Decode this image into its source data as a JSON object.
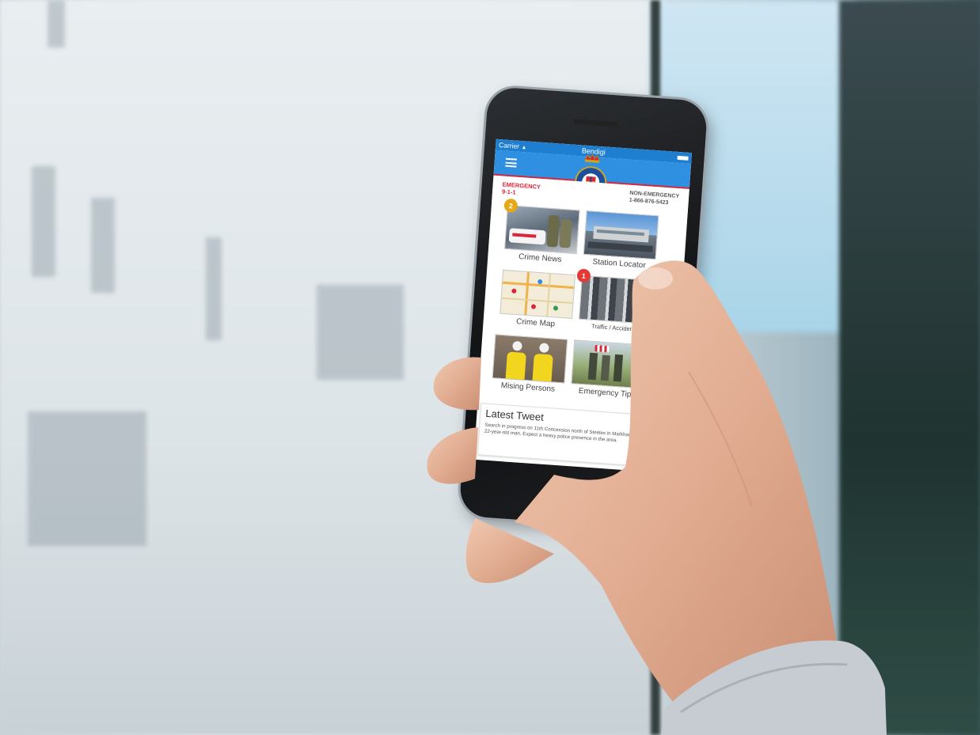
{
  "status_bar": {
    "carrier": "Carrier",
    "wifi_icon": "wifi-icon",
    "title": "Bendigi"
  },
  "header": {
    "menu_icon": "hamburger-menu-icon",
    "logo": "police-crest-logo"
  },
  "contacts": {
    "emergency_label": "EMERGENCY",
    "emergency_number": "9-1-1",
    "non_emergency_label": "NON-EMERGENCY",
    "non_emergency_number": "1-866-876-5423"
  },
  "tiles": [
    {
      "label": "Crime News",
      "badge": "2"
    },
    {
      "label": "Station Locator",
      "badge": ""
    },
    {
      "label": "Crime Map",
      "badge": ""
    },
    {
      "label": "Traffic / Accidents",
      "badge": "1"
    },
    {
      "label": "Mising Persons",
      "badge": ""
    },
    {
      "label": "Emergency Tips",
      "badge": ""
    }
  ],
  "tweet": {
    "heading": "Latest Tweet",
    "icon": "twitter-bird-icon",
    "text": "Search in progress on 11th Concession north of Steeles in Markham for missing 22-year-old man. Expect a heavy police presence in the area."
  },
  "colors": {
    "accent": "#2f8fe0",
    "emergency": "#d9263a",
    "badge_yellow": "#e6a817",
    "badge_red": "#e53935"
  }
}
